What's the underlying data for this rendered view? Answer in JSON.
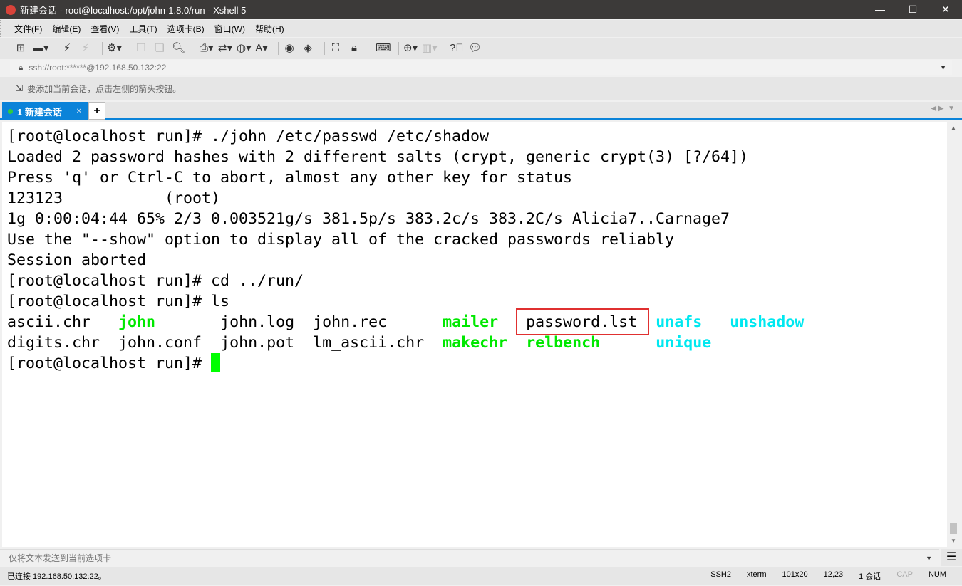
{
  "window": {
    "title": "新建会话 - root@localhost:/opt/john-1.8.0/run - Xshell 5",
    "controls": [
      "—",
      "☐",
      "✕"
    ]
  },
  "menu": [
    "文件(F)",
    "编辑(E)",
    "查看(V)",
    "工具(T)",
    "选项卡(B)",
    "窗口(W)",
    "帮助(H)"
  ],
  "toolbar_icons": [
    "new-session-icon",
    "open-folder-icon",
    "connect-icon",
    "disconnect-icon",
    "properties-icon",
    "copy-icon",
    "paste-icon",
    "find-icon",
    "print-icon",
    "transfer-icon",
    "globe-icon",
    "font-icon",
    "xshell-icon",
    "xftp-icon",
    "fullscreen-icon",
    "lock-icon",
    "keyboard-icon",
    "new-tab-icon",
    "layout-icon",
    "help-icon",
    "chat-icon"
  ],
  "address": {
    "value": "ssh://root:******@192.168.50.132:22"
  },
  "hint": "要添加当前会话，点击左侧的箭头按钮。",
  "tabs": [
    {
      "label": "1 新建会话",
      "active": true
    }
  ],
  "terminal": {
    "lines": [
      "[root@localhost run]# ./john /etc/passwd /etc/shadow",
      "Loaded 2 password hashes with 2 different salts (crypt, generic crypt(3) [?/64])",
      "Press 'q' or Ctrl-C to abort, almost any other key for status",
      "123123           (root)",
      "1g 0:00:04:44 65% 2/3 0.003521g/s 381.5p/s 383.2c/s 383.2C/s Alicia7..Carnage7",
      "Use the \"--show\" option to display all of the cracked passwords reliably",
      "Session aborted",
      "[root@localhost run]# cd ../run/",
      "[root@localhost run]# ls"
    ],
    "ls_row1": [
      {
        "name": "ascii.chr",
        "type": "file"
      },
      {
        "name": "john",
        "type": "exec"
      },
      {
        "name": "john.log",
        "type": "file"
      },
      {
        "name": "john.rec",
        "type": "file"
      },
      {
        "name": "mailer",
        "type": "exec"
      },
      {
        "name": "password.lst",
        "type": "file",
        "highlighted": true
      },
      {
        "name": "unafs",
        "type": "link"
      },
      {
        "name": "unshadow",
        "type": "link"
      }
    ],
    "ls_row2": [
      {
        "name": "digits.chr",
        "type": "file"
      },
      {
        "name": "john.conf",
        "type": "file"
      },
      {
        "name": "john.pot",
        "type": "file"
      },
      {
        "name": "lm_ascii.chr",
        "type": "file"
      },
      {
        "name": "makechr",
        "type": "exec"
      },
      {
        "name": "relbench",
        "type": "exec"
      },
      {
        "name": "unique",
        "type": "link"
      }
    ],
    "prompt": "[root@localhost run]# ",
    "colors": {
      "exec": "#00e800",
      "link": "#00e8f0",
      "highlight_box": "#e03030"
    }
  },
  "sendbar": {
    "placeholder": "仅将文本发送到当前选项卡"
  },
  "status": {
    "left": "已连接 192.168.50.132:22。",
    "protocol": "SSH2",
    "term": "xterm",
    "size": "101x20",
    "cursor": "12,23",
    "sessions": "1 会话",
    "cap": "CAP",
    "num": "NUM"
  }
}
